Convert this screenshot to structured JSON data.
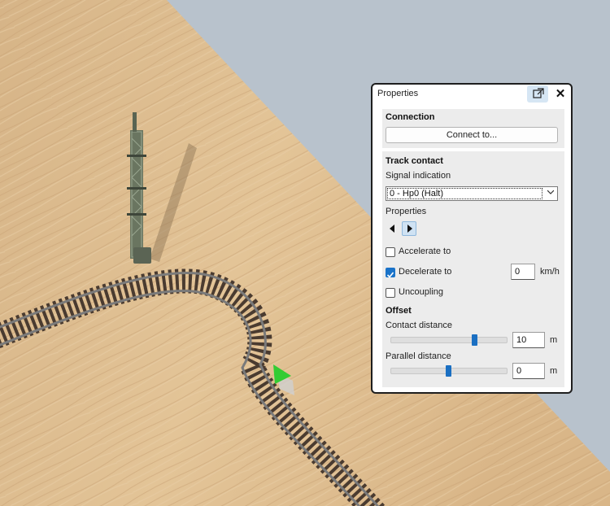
{
  "panel": {
    "title": "Properties",
    "popout_icon": "popout-icon",
    "close_glyph": "✕"
  },
  "connection": {
    "heading": "Connection",
    "connect_label": "Connect to..."
  },
  "track_contact": {
    "heading": "Track contact",
    "signal_label": "Signal indication",
    "signal_value": "0 - Hp0 (Halt)",
    "properties_label": "Properties",
    "accelerate_label": "Accelerate to",
    "accelerate_checked": false,
    "decelerate_label": "Decelerate to",
    "decelerate_checked": true,
    "decelerate_value": "0",
    "decelerate_unit": "km/h",
    "uncoupling_label": "Uncoupling",
    "uncoupling_checked": false
  },
  "offset": {
    "heading": "Offset",
    "contact_label": "Contact distance",
    "contact_value": "10",
    "contact_unit": "m",
    "parallel_label": "Parallel distance",
    "parallel_value": "0",
    "parallel_unit": "m"
  },
  "colors": {
    "accent": "#1a73c9",
    "wood": "#dbb98a",
    "background": "#b8c2cc"
  }
}
